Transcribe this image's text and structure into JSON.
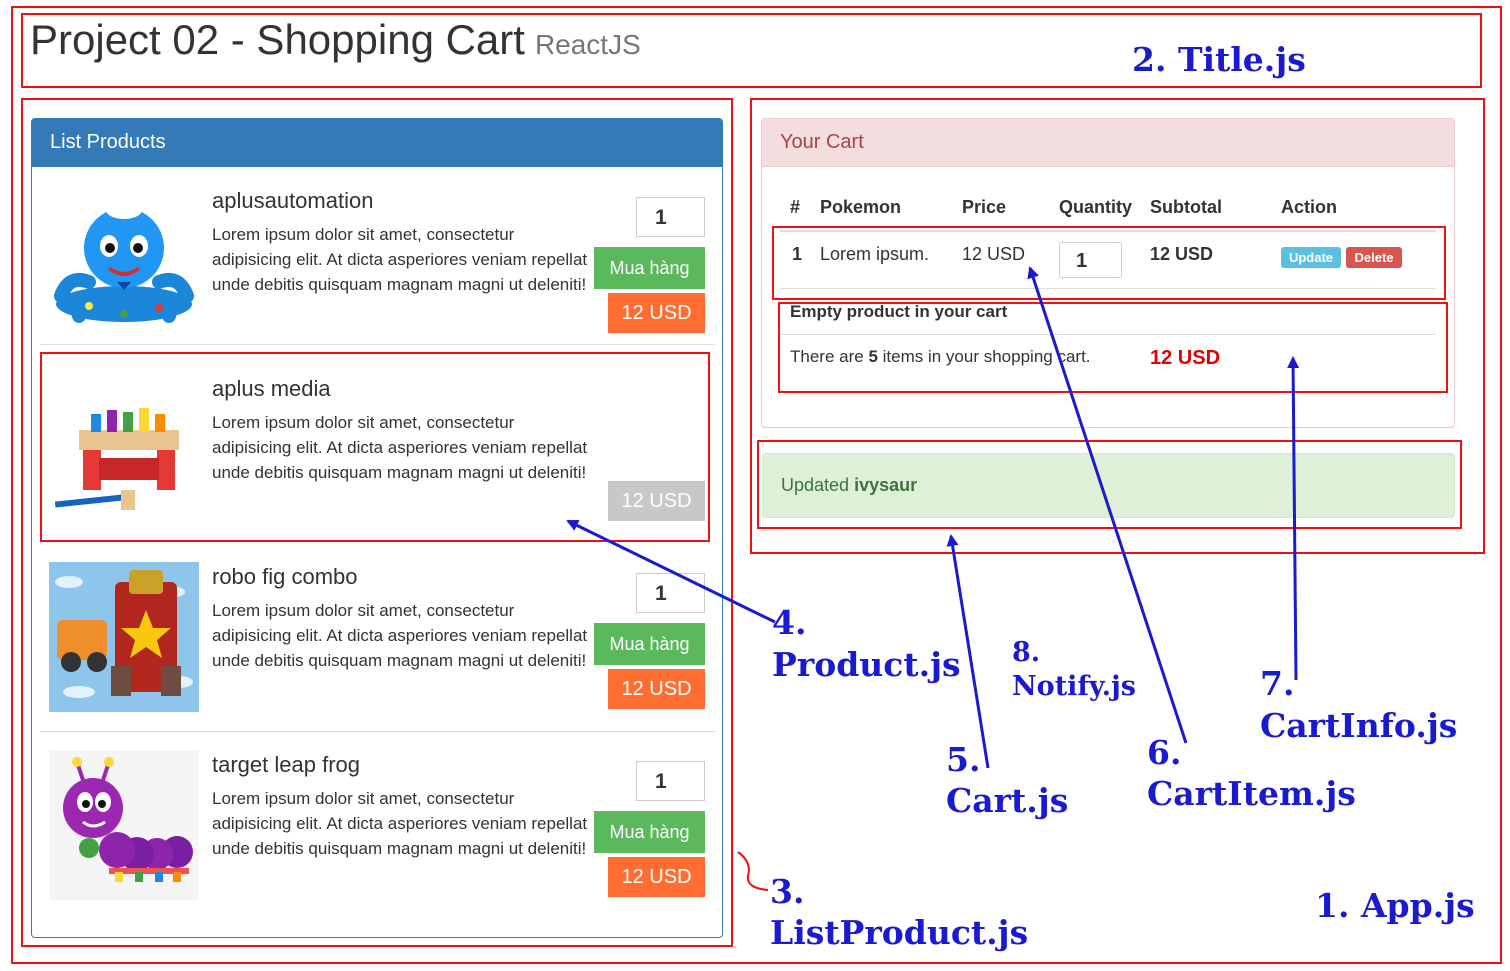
{
  "title": {
    "main": "Project 02 - Shopping Cart",
    "sub": "ReactJS"
  },
  "list_products": {
    "heading": "List Products",
    "buy_label": "Mua hàng",
    "items": [
      {
        "name": "aplusautomation",
        "description": "Lorem ipsum dolor sit amet, consectetur adipisicing elit. At dicta asperiores veniam repellat unde debitis quisquam magnam magni ut deleniti!",
        "quantity": "1",
        "price": "12 USD",
        "image": "blue-octopus-toy"
      },
      {
        "name": "aplus media",
        "description": "Lorem ipsum dolor sit amet, consectetur adipisicing elit. At dicta asperiores veniam repellat unde debitis quisquam magnam magni ut deleniti!",
        "price": "12 USD",
        "image": "pound-bench-toy"
      },
      {
        "name": "robo fig combo",
        "description": "Lorem ipsum dolor sit amet, consectetur adipisicing elit. At dicta asperiores veniam repellat unde debitis quisquam magnam magni ut deleniti!",
        "quantity": "1",
        "price": "12 USD",
        "image": "robot-figure-toy"
      },
      {
        "name": "target leap frog",
        "description": "Lorem ipsum dolor sit amet, consectetur adipisicing elit. At dicta asperiores veniam repellat unde debitis quisquam magnam magni ut deleniti!",
        "quantity": "1",
        "price": "12 USD",
        "image": "caterpillar-toy"
      }
    ]
  },
  "cart": {
    "heading": "Your Cart",
    "columns": [
      "#",
      "Pokemon",
      "Price",
      "Quantity",
      "Subtotal",
      "Action"
    ],
    "row": {
      "index": "1",
      "name": "Lorem ipsum.",
      "price": "12 USD",
      "quantity": "1",
      "subtotal": "12 USD",
      "update_label": "Update",
      "delete_label": "Delete"
    },
    "empty_message": "Empty product in your cart",
    "info": {
      "prefix": "There are",
      "count": "5",
      "suffix": "items in your shopping cart.",
      "total": "12 USD"
    }
  },
  "notify": {
    "prefix": "Updated",
    "name": "ivysaur"
  },
  "annotations": {
    "app": "1. App.js",
    "title": "2. Title.js",
    "list_num": "3.",
    "list_name": "ListProduct.js",
    "product_num": "4.",
    "product_name": "Product.js",
    "cart_num": "5.",
    "cart_name": "Cart.js",
    "cartitem_num": "6.",
    "cartitem_name": "CartItem.js",
    "cartinfo_num": "7.",
    "cartinfo_name": "CartInfo.js",
    "notify_num": "8.",
    "notify_name": "Notify.js"
  },
  "colors": {
    "primary": "#337ab7",
    "success": "#5cb85c",
    "price": "#ff6d33",
    "info": "#5bc0de",
    "danger": "#d9534f",
    "annotation": "#1a1acf",
    "outline": "#ee1111"
  }
}
